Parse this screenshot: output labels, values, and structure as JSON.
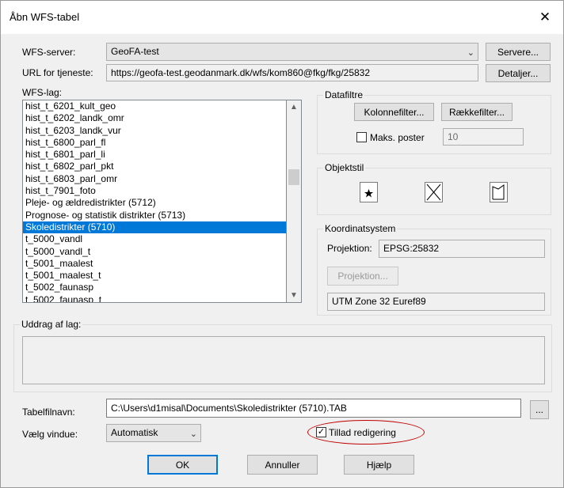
{
  "window": {
    "title": "Åbn WFS-tabel",
    "close": "✕"
  },
  "server": {
    "label": "WFS-server:",
    "value": "GeoFA-test",
    "button": "Servere..."
  },
  "url": {
    "label": "URL for tjeneste:",
    "value": "https://geofa-test.geodanmark.dk/wfs/kom860@fkg/fkg/25832",
    "button": "Detaljer..."
  },
  "layers": {
    "label": "WFS-lag:",
    "items": [
      "hist_t_6201_kult_geo",
      "hist_t_6202_landk_omr",
      "hist_t_6203_landk_vur",
      "hist_t_6800_parl_fl",
      "hist_t_6801_parl_li",
      "hist_t_6802_parl_pkt",
      "hist_t_6803_parl_omr",
      "hist_t_7901_foto",
      "Pleje- og ældredistrikter (5712)",
      "Prognose- og statistik distrikter (5713)",
      "Skoledistrikter (5710)",
      "t_5000_vandl",
      "t_5000_vandl_t",
      "t_5001_maalest",
      "t_5001_maalest_t",
      "t_5002_faunasp",
      "t_5002_faunasp_t"
    ],
    "selected_index": 10,
    "scroll_up": "▲",
    "scroll_down": "▼"
  },
  "filters": {
    "title": "Datafiltre",
    "column_button": "Kolonnefilter...",
    "row_button": "Rækkefilter...",
    "max_label": "Maks. poster",
    "max_value": "10",
    "max_checked": false
  },
  "style": {
    "title": "Objektstil",
    "icons": [
      "point-style-icon",
      "line-style-icon",
      "region-style-icon"
    ]
  },
  "coords": {
    "title": "Koordinatsystem",
    "projection_label": "Projektion:",
    "projection_value": "EPSG:25832",
    "projection_button": "Projektion...",
    "system_name": "UTM Zone 32 Euref89"
  },
  "extract": {
    "title": "Uddrag af lag:"
  },
  "table": {
    "label": "Tabelfilnavn:",
    "value": "C:\\Users\\d1misal\\Documents\\Skoledistrikter (5710).TAB",
    "browse": "..."
  },
  "window_select": {
    "label": "Vælg vindue:",
    "value": "Automatisk"
  },
  "edit": {
    "label": "Tillad redigering",
    "checked": true,
    "check_mark": "✓"
  },
  "buttons": {
    "ok": "OK",
    "cancel": "Annuller",
    "help": "Hjælp"
  },
  "colors": {
    "accent": "#0078d7",
    "highlight_oval": "#c00000"
  }
}
